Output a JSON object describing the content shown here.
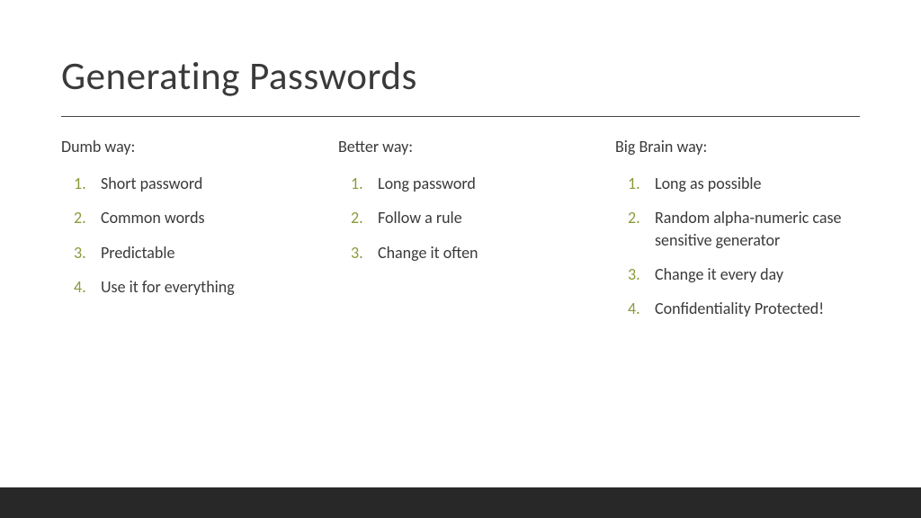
{
  "title": "Generating Passwords",
  "columns": [
    {
      "heading": "Dumb way:",
      "items": [
        "Short password",
        "Common words",
        "Predictable",
        "Use it for everything"
      ]
    },
    {
      "heading": "Better way:",
      "items": [
        "Long password",
        "Follow a rule",
        "Change it often"
      ]
    },
    {
      "heading": "Big Brain way:",
      "items": [
        "Long as possible",
        "Random alpha-numeric case sensitive generator",
        "Change it every day",
        "Confidentiality Protected!"
      ]
    }
  ]
}
